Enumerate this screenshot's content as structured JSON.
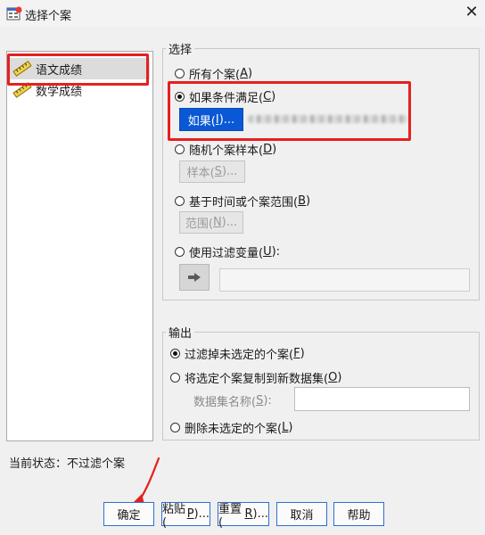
{
  "window": {
    "title": "选择个案",
    "close_label": "✕"
  },
  "variables": [
    {
      "label": "语文成绩"
    },
    {
      "label": "数学成绩"
    }
  ],
  "select": {
    "legend": "选择",
    "all_cases": {
      "label": "所有个案(",
      "key": "A",
      "end": ")"
    },
    "if_condition": {
      "label": "如果条件满足(",
      "key": "C",
      "end": ")"
    },
    "if_button": {
      "label": "如果(",
      "key": "I",
      "end": ")..."
    },
    "random_sample": {
      "label": "随机个案样本(",
      "key": "D",
      "end": ")"
    },
    "sample_button": {
      "label": "样本(",
      "key": "S",
      "end": ")..."
    },
    "time_range": {
      "label": "基于时间或个案范围(",
      "key": "B",
      "end": ")"
    },
    "range_button": {
      "label": "范围(",
      "key": "N",
      "end": ")..."
    },
    "filter_variable": {
      "label": "使用过滤变量(",
      "key": "U",
      "end": "):"
    },
    "filter_value": ""
  },
  "output": {
    "legend": "输出",
    "filter_out": {
      "label": "过滤掉未选定的个案(",
      "key": "F",
      "end": ")"
    },
    "copy_new": {
      "label": "将选定个案复制到新数据集(",
      "key": "O",
      "end": ")"
    },
    "dataset_name": {
      "label": "数据集名称(",
      "key": "S",
      "end": "):"
    },
    "dataset_value": "",
    "delete": {
      "label": "删除未选定的个案(",
      "key": "L",
      "end": ")"
    }
  },
  "status": "当前状态：不过滤个案",
  "footer": {
    "ok": "确定",
    "paste": "粘贴(",
    "paste_key": "P",
    "paste_end": ")...",
    "reset": "重置(",
    "reset_key": "R",
    "reset_end": ")...",
    "cancel": "取消",
    "help": "帮助"
  },
  "colors": {
    "highlight": "#e52020",
    "primary_button": "#0a58d6"
  },
  "icons": [
    "spss-app-icon",
    "close-icon",
    "ruler-icon",
    "arrow-right-icon"
  ]
}
